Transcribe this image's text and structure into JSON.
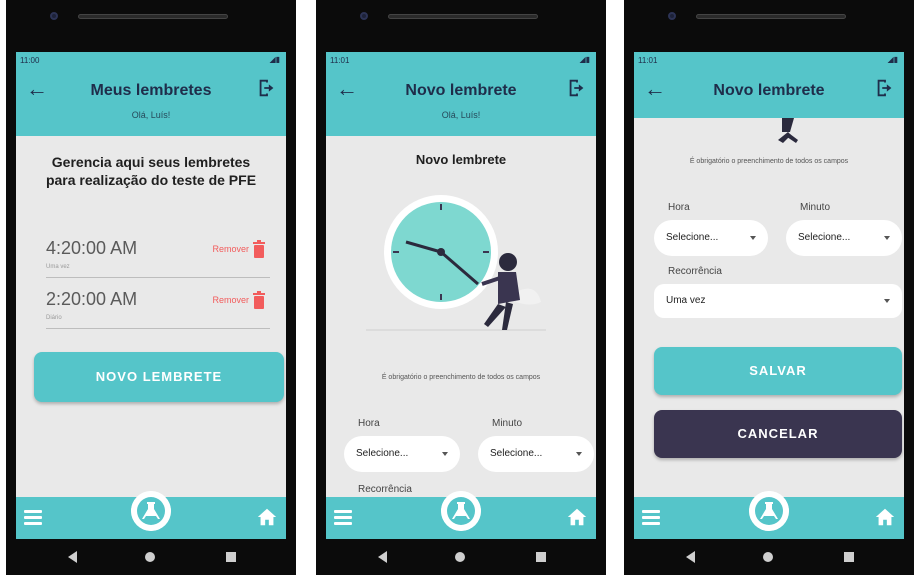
{
  "screens": [
    {
      "status_time": "11:00",
      "title": "Meus lembretes",
      "greeting": "Olá, Luís!",
      "intro": "Gerencia aqui seus lembretes para realização do teste de PFE",
      "reminders": [
        {
          "time": "4:20:00 AM",
          "recurrence": "Uma vez",
          "remove_label": "Remover"
        },
        {
          "time": "2:20:00 AM",
          "recurrence": "Diário",
          "remove_label": "Remover"
        }
      ],
      "new_button": "NOVO LEMBRETE"
    },
    {
      "status_time": "11:01",
      "title": "Novo lembrete",
      "greeting": "Olá, Luís!",
      "heading": "Novo lembrete",
      "required_note": "É obrigatório o preenchimento de todos os campos",
      "hour_label": "Hora",
      "minute_label": "Minuto",
      "hour_value": "Selecione...",
      "minute_value": "Selecione...",
      "recurrence_label": "Recorrência"
    },
    {
      "status_time": "11:01",
      "title": "Novo lembrete",
      "required_note": "É obrigatório o preenchimento de todos os campos",
      "hour_label": "Hora",
      "minute_label": "Minuto",
      "hour_value": "Selecione...",
      "minute_value": "Selecione...",
      "recurrence_label": "Recorrência",
      "recurrence_value": "Uma vez",
      "save_button": "SALVAR",
      "cancel_button": "CANCELAR"
    }
  ],
  "colors": {
    "accent": "#55c5c9",
    "dark_button": "#3a3550",
    "remove_red": "#f25c5c",
    "background": "#e9e9e9"
  },
  "icons": {
    "back": "arrow-left-icon",
    "logout": "logout-icon",
    "menu": "hamburger-menu-icon",
    "center": "flask-logo-icon",
    "home": "home-icon",
    "remove": "trash-icon"
  }
}
